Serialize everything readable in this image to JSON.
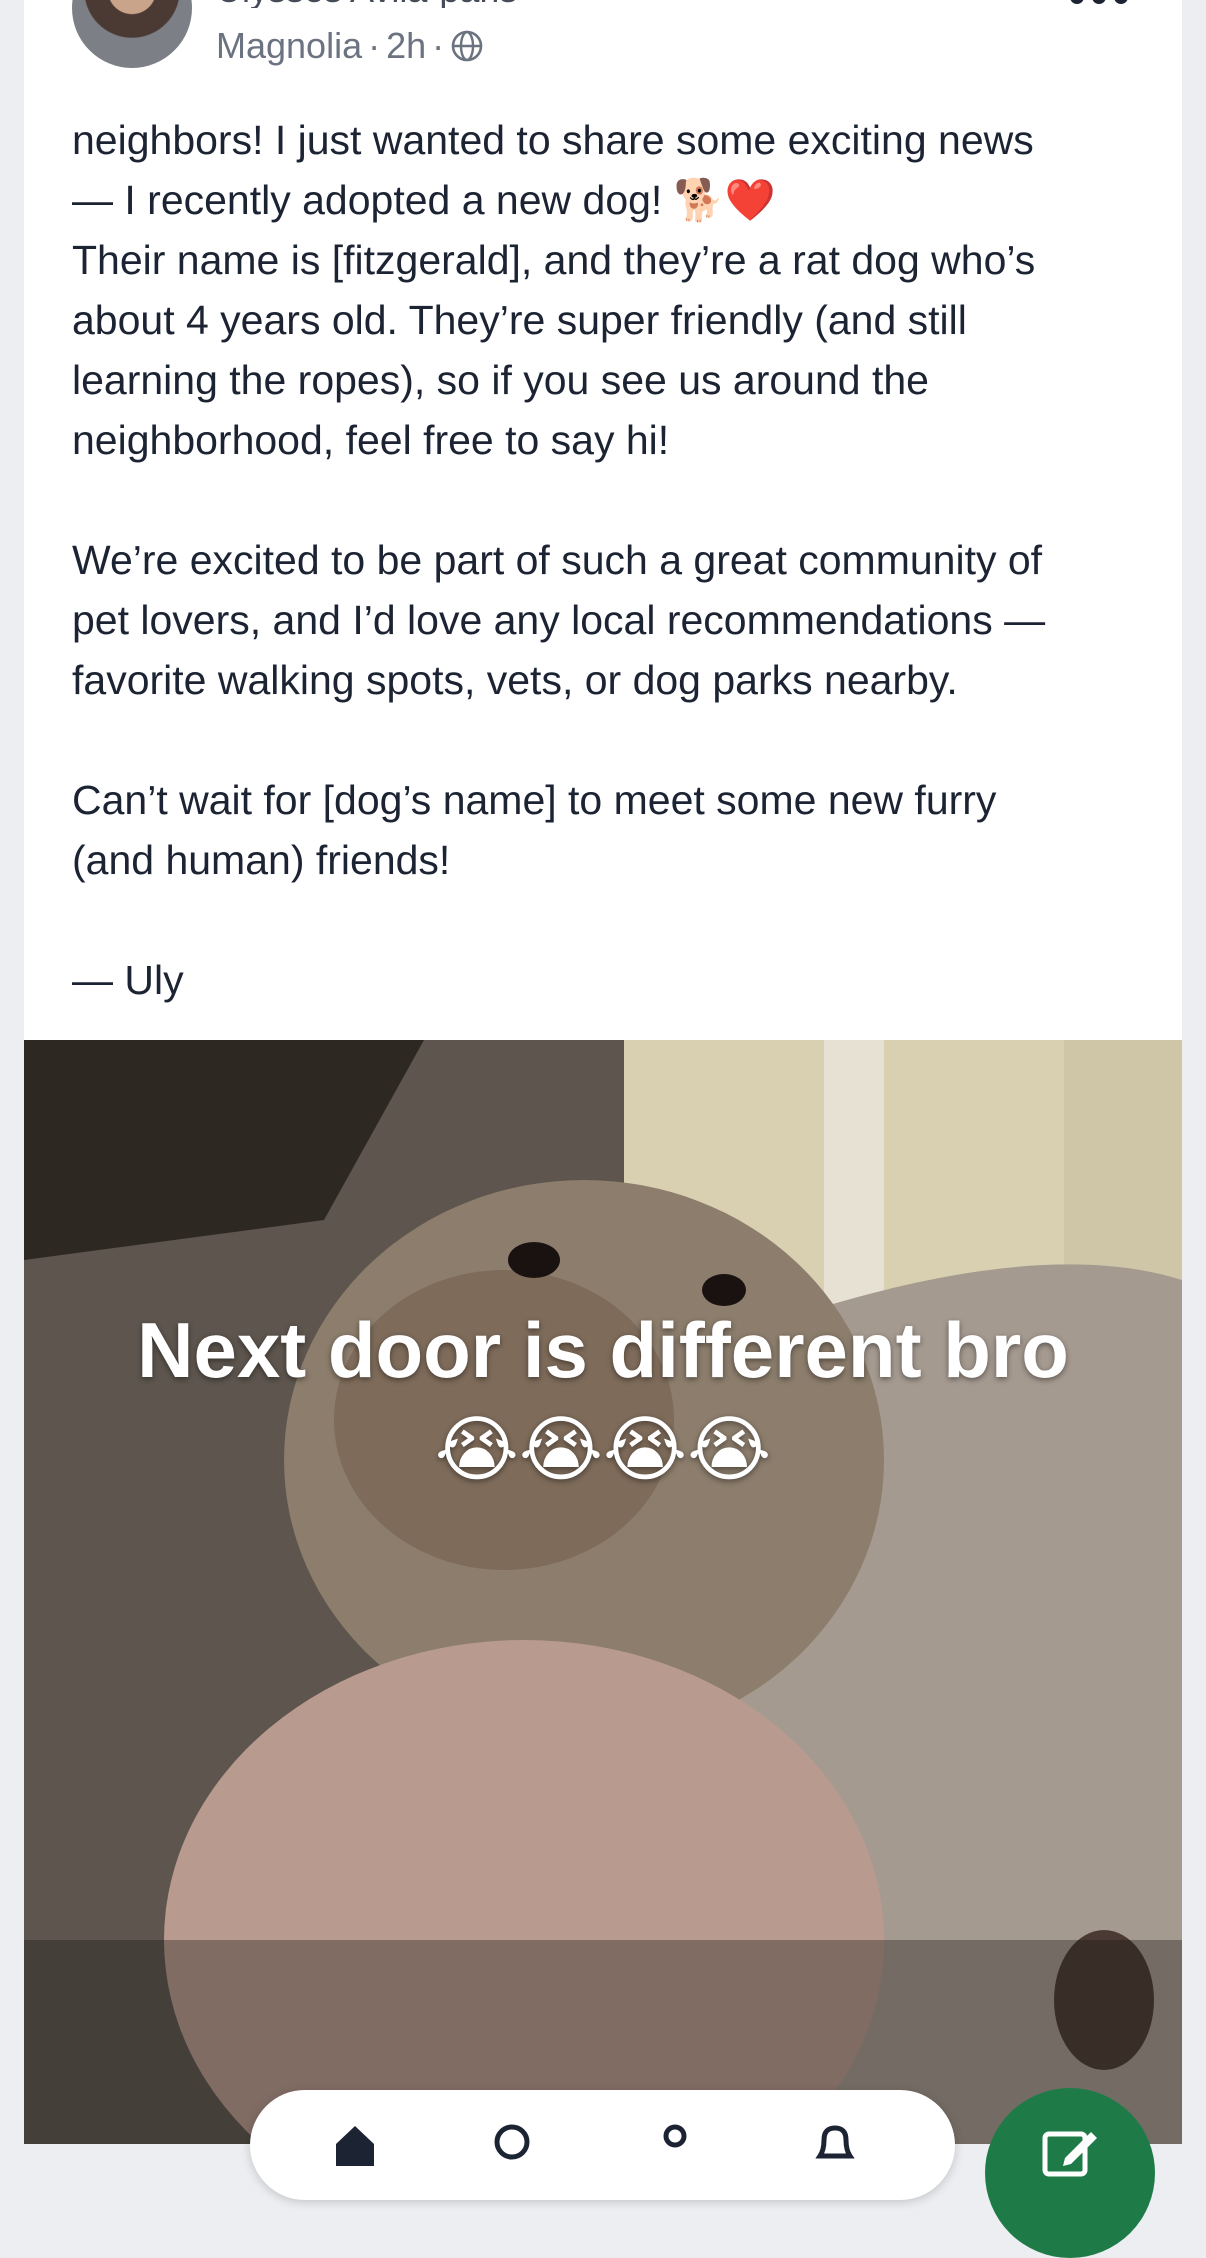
{
  "post": {
    "author_name": "Ulysses Avila-paris",
    "location": "Magnolia",
    "time": "2h",
    "separator": "·",
    "visibility_icon": "globe-icon",
    "more_icon": "more-options-icon",
    "body": {
      "line1": "neighbors! I just wanted to share some exciting news",
      "line2": "— I recently adopted a new dog! 🐕❤️",
      "line3": "Their name is [fitzgerald], and they’re a rat dog who’s",
      "line4": "about 4 years old. They’re super friendly (and still",
      "line5": "learning the ropes), so if you see us around the",
      "line6": "neighborhood, feel free to say hi!",
      "line7": "We’re excited to be part of such a great community of",
      "line8": "pet lovers, and I’d love any local recommendations —",
      "line9": "favorite walking spots, vets, or dog parks nearby.",
      "line10": "Can’t wait for [dog’s name] to meet some new furry",
      "line11": "(and human) friends!",
      "line12": "— Uly"
    },
    "image": {
      "caption_line1": "Next door is different bro",
      "caption_line2": "😭😭😭😭"
    }
  },
  "bottom_nav": {
    "icons": [
      "home-icon",
      "search-icon",
      "profile-icon",
      "notifications-icon"
    ]
  },
  "fab": {
    "icon": "compose-icon",
    "color": "#1e7b48"
  }
}
